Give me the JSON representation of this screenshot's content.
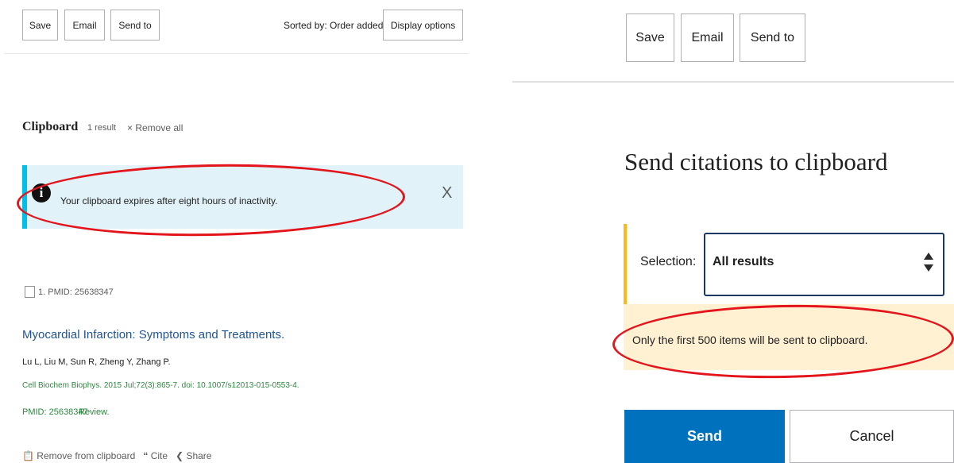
{
  "left": {
    "toolbar": {
      "save_label": "Save",
      "email_label": "Email",
      "send_to_label": "Send to",
      "sorted_by": "Sorted by: Order added",
      "display_options_label": "Display options"
    },
    "clipboard": {
      "title": "Clipboard",
      "count": "1 result",
      "remove_all": "× Remove all"
    },
    "banner": {
      "icon": "info-icon",
      "icon_glyph": "i",
      "text": "Your clipboard expires after eight hours of inactivity.",
      "close": "X"
    },
    "result": {
      "header": "1. PMID: 25638347",
      "title": "Myocardial Infarction: Symptoms and Treatments.",
      "authors": "Lu L, Liu M, Sun R, Zheng Y, Zhang P.",
      "journal": "Cell Biochem Biophys. 2015 Jul;72(3):865-7. doi: 10.1007/s12013-015-0553-4.",
      "pmid": "PMID: 25638347",
      "type": "Review.",
      "actions": {
        "remove": "Remove from clipboard",
        "cite": "Cite",
        "share": "Share"
      }
    }
  },
  "right": {
    "toolbar": {
      "save_label": "Save",
      "email_label": "Email",
      "send_to_label": "Send to"
    },
    "dialog": {
      "title": "Send citations to clipboard",
      "selection_label": "Selection:",
      "selection_value": "All results",
      "warning": "Only the first 500 items will be sent to clipboard.",
      "send_label": "Send",
      "cancel_label": "Cancel"
    }
  },
  "colors": {
    "primary_button": "#0071bc",
    "link": "#205493",
    "citation_green": "#2e8540",
    "info_banner": "#e1f3f8",
    "info_border": "#02bfe7",
    "warning_bg": "#fff1d2",
    "warning_border": "#fdb81e",
    "annotation_red": "#e3141b"
  }
}
